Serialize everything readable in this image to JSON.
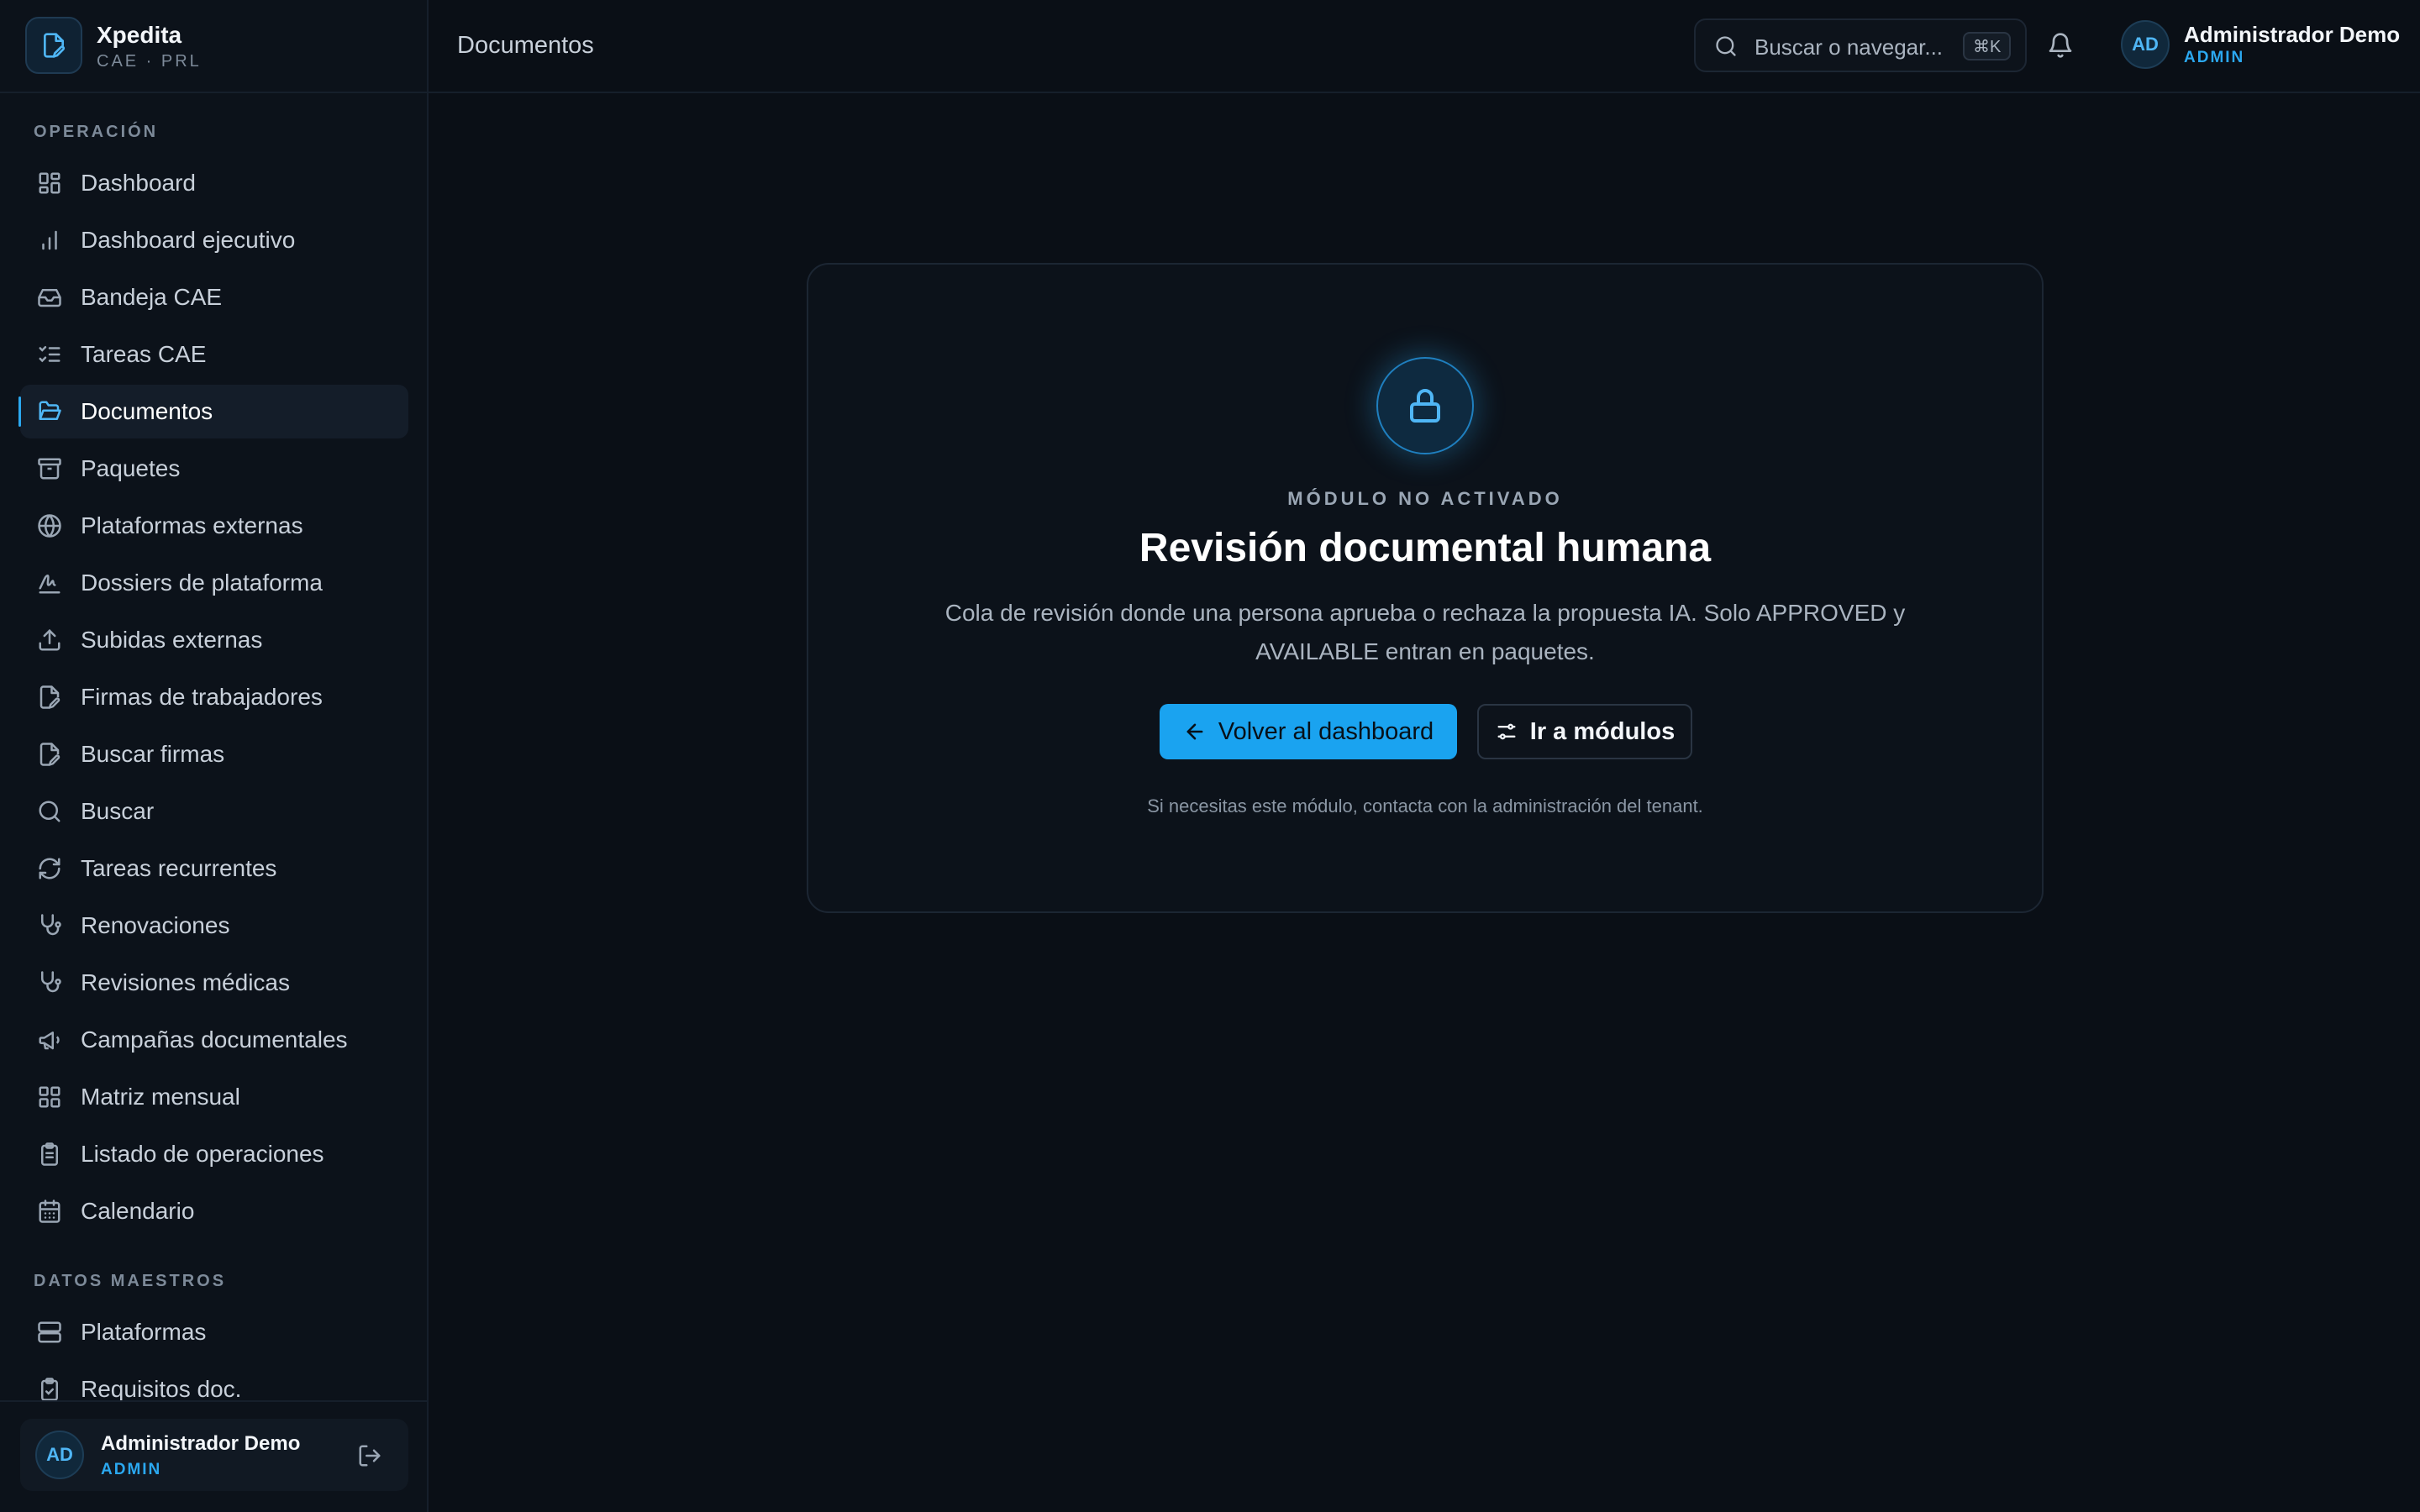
{
  "brand": {
    "name": "Xpedita",
    "subtitle": "CAE · PRL"
  },
  "header": {
    "page_title": "Documentos",
    "search_placeholder": "Buscar o navegar...",
    "search_shortcut": "⌘K",
    "user": {
      "initials": "AD",
      "name": "Administrador Demo",
      "role": "ADMIN"
    }
  },
  "sidebar": {
    "sections": [
      {
        "title": "OPERACIÓN",
        "items": [
          {
            "label": "Dashboard",
            "icon": "dashboard-icon"
          },
          {
            "label": "Dashboard ejecutivo",
            "icon": "bar-chart-icon"
          },
          {
            "label": "Bandeja CAE",
            "icon": "inbox-icon"
          },
          {
            "label": "Tareas CAE",
            "icon": "list-checks-icon"
          },
          {
            "label": "Documentos",
            "icon": "folder-open-icon",
            "active": true
          },
          {
            "label": "Paquetes",
            "icon": "archive-icon"
          },
          {
            "label": "Plataformas externas",
            "icon": "globe-icon"
          },
          {
            "label": "Dossiers de plataforma",
            "icon": "signature-icon"
          },
          {
            "label": "Subidas externas",
            "icon": "upload-icon"
          },
          {
            "label": "Firmas de trabajadores",
            "icon": "file-pen-icon"
          },
          {
            "label": "Buscar firmas",
            "icon": "file-search-icon"
          },
          {
            "label": "Buscar",
            "icon": "search-icon"
          },
          {
            "label": "Tareas recurrentes",
            "icon": "refresh-icon"
          },
          {
            "label": "Renovaciones",
            "icon": "stethoscope-icon"
          },
          {
            "label": "Revisiones médicas",
            "icon": "stethoscope-icon"
          },
          {
            "label": "Campañas documentales",
            "icon": "megaphone-icon"
          },
          {
            "label": "Matriz mensual",
            "icon": "grid-icon"
          },
          {
            "label": "Listado de operaciones",
            "icon": "clipboard-list-icon"
          },
          {
            "label": "Calendario",
            "icon": "calendar-icon"
          }
        ]
      },
      {
        "title": "DATOS MAESTROS",
        "items": [
          {
            "label": "Plataformas",
            "icon": "server-icon"
          },
          {
            "label": "Requisitos doc.",
            "icon": "clipboard-check-icon"
          }
        ]
      }
    ],
    "footer_user": {
      "initials": "AD",
      "name": "Administrador Demo",
      "role": "ADMIN"
    }
  },
  "card": {
    "icon": "lock-icon",
    "eyebrow": "MÓDULO NO ACTIVADO",
    "title": "Revisión documental humana",
    "description": "Cola de revisión donde una persona aprueba o rechaza la propuesta IA. Solo APPROVED y AVAILABLE entran en paquetes.",
    "primary_button": "Volver al dashboard",
    "secondary_button": "Ir a módulos",
    "note": "Si necesitas este módulo, contacta con la administración del tenant."
  },
  "colors": {
    "accent": "#1aa3f0",
    "background": "#0a0f16",
    "sidebar": "#0c121a"
  }
}
